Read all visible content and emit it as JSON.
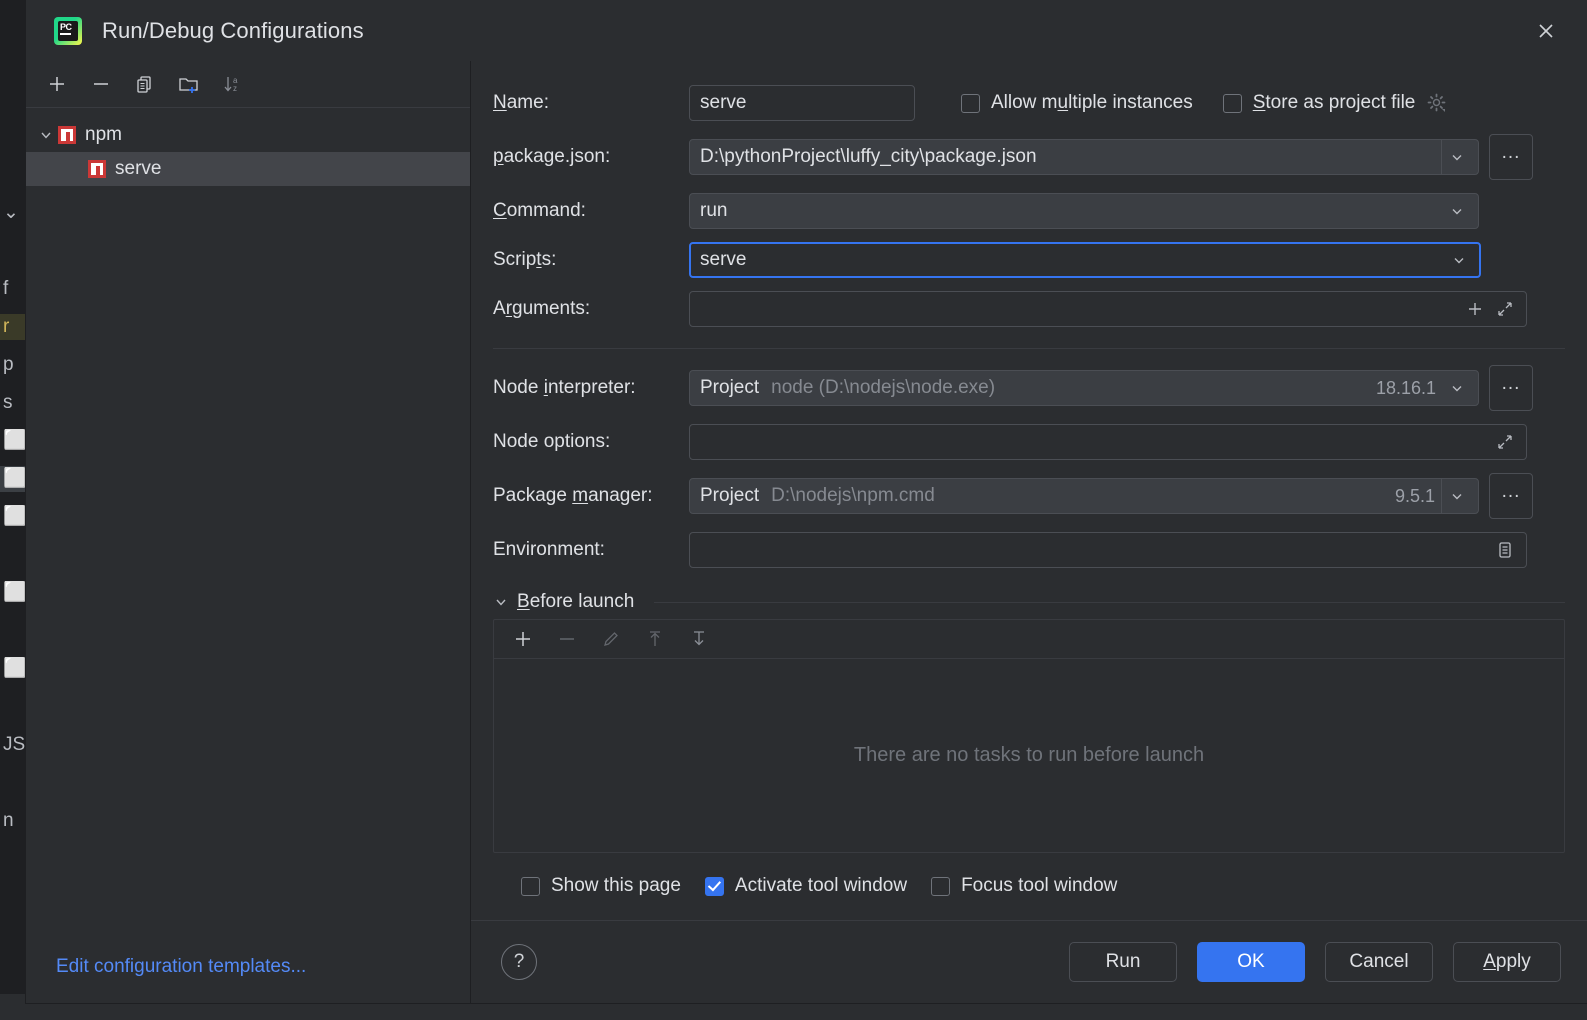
{
  "window": {
    "title": "Run/Debug Configurations",
    "app_icon": "pycharm-logo-icon",
    "close_icon": "close-icon"
  },
  "left_panel": {
    "toolbar": [
      {
        "name": "add-configuration-button",
        "icon": "plus-icon"
      },
      {
        "name": "remove-configuration-button",
        "icon": "minus-icon"
      },
      {
        "name": "copy-configuration-button",
        "icon": "copy-icon"
      },
      {
        "name": "new-folder-button",
        "icon": "folder-add-icon"
      },
      {
        "name": "sort-configurations-button",
        "icon": "sort-az-icon"
      }
    ],
    "tree": [
      {
        "label": "npm",
        "icon": "npm-icon",
        "level": 0,
        "expanded": true,
        "selected": false
      },
      {
        "label": "serve",
        "icon": "npm-icon",
        "level": 1,
        "expanded": false,
        "selected": true
      }
    ],
    "edit_templates_link": "Edit configuration templates..."
  },
  "form": {
    "name": {
      "label": "Name:",
      "mnemonic": "N",
      "value": "serve"
    },
    "allow_multiple_instances": {
      "label": "Allow m",
      "mnemonic": "u",
      "label_rest": "ltiple instances",
      "checked": false
    },
    "store_as_project_file": {
      "label_pre": "",
      "mnemonic": "S",
      "label_rest": "tore as project file",
      "checked": false,
      "gear_icon": "gear-icon"
    },
    "package_json": {
      "label": "package.json:",
      "mnemonic": "p",
      "value": "D:\\pythonProject\\luffy_city\\package.json",
      "browse_label": "..."
    },
    "command": {
      "label": "Command:",
      "mnemonic": "C",
      "value": "run"
    },
    "scripts": {
      "label": "Scripts:",
      "mnemonic": "t",
      "value": "serve",
      "focused": true
    },
    "arguments": {
      "label": "Arguments:",
      "mnemonic": "r",
      "value": "",
      "add_icon": "plus-icon",
      "expand_icon": "expand-icon"
    },
    "node_interpreter": {
      "label": "Node interpreter:",
      "mnemonic": "i",
      "scope": "Project",
      "path": "node (D:\\nodejs\\node.exe)",
      "version": "18.16.1",
      "browse_label": "..."
    },
    "node_options": {
      "label": "Node options:",
      "value": "",
      "expand_icon": "expand-icon"
    },
    "package_manager": {
      "label": "Package manager:",
      "mnemonic": "m",
      "scope": "Project",
      "path": "D:\\nodejs\\npm.cmd",
      "version": "9.5.1",
      "browse_label": "..."
    },
    "environment": {
      "label": "Environment:",
      "value": "",
      "edit_icon": "environment-variables-icon"
    }
  },
  "before_launch": {
    "title_pre": "",
    "mnemonic": "B",
    "title_rest": "efore launch",
    "expanded": true,
    "toolbar": [
      {
        "name": "add-task-button",
        "icon": "plus-icon",
        "enabled": true
      },
      {
        "name": "remove-task-button",
        "icon": "minus-icon",
        "enabled": false
      },
      {
        "name": "edit-task-button",
        "icon": "pencil-icon",
        "enabled": false
      },
      {
        "name": "move-task-up-button",
        "icon": "arrow-up-icon",
        "enabled": false
      },
      {
        "name": "move-task-down-button",
        "icon": "arrow-down-icon",
        "enabled": false
      }
    ],
    "empty_text": "There are no tasks to run before launch",
    "checkboxes": [
      {
        "label": "Show this page",
        "checked": false,
        "name": "show-this-page-checkbox"
      },
      {
        "label": "Activate tool window",
        "checked": true,
        "name": "activate-tool-window-checkbox"
      },
      {
        "label": "Focus tool window",
        "checked": false,
        "name": "focus-tool-window-checkbox"
      }
    ]
  },
  "footer": {
    "help_icon": "help-icon",
    "buttons": [
      {
        "label": "Run",
        "primary": false,
        "name": "run-button"
      },
      {
        "label": "OK",
        "primary": true,
        "name": "ok-button"
      },
      {
        "label": "Cancel",
        "primary": false,
        "name": "cancel-button"
      },
      {
        "label": "Apply",
        "primary": false,
        "name": "apply-button",
        "mnemonic": "A"
      }
    ]
  },
  "background_ide": {
    "rows": [
      {
        "t": "⌄",
        "c": ""
      },
      {
        "t": "",
        "c": ""
      },
      {
        "t": "f",
        "c": ""
      },
      {
        "t": "r",
        "c": "hl"
      },
      {
        "t": "p",
        "c": ""
      },
      {
        "t": "s",
        "c": ""
      },
      {
        "t": "⬜",
        "c": ""
      },
      {
        "t": "⬜",
        "c": "sel"
      },
      {
        "t": "⬜",
        "c": ""
      },
      {
        "t": "",
        "c": ""
      },
      {
        "t": "⬜",
        "c": ""
      },
      {
        "t": "",
        "c": ""
      },
      {
        "t": "⬜",
        "c": ""
      },
      {
        "t": "",
        "c": ""
      },
      {
        "t": "JS",
        "c": ""
      },
      {
        "t": "",
        "c": ""
      },
      {
        "t": "n",
        "c": ""
      }
    ]
  },
  "colors": {
    "dialog_bg": "#2b2d30",
    "accent": "#3574f0",
    "link": "#548af7",
    "npm_red": "#cb3837",
    "field_border": "#4b4e54",
    "muted_text": "#868a91"
  }
}
